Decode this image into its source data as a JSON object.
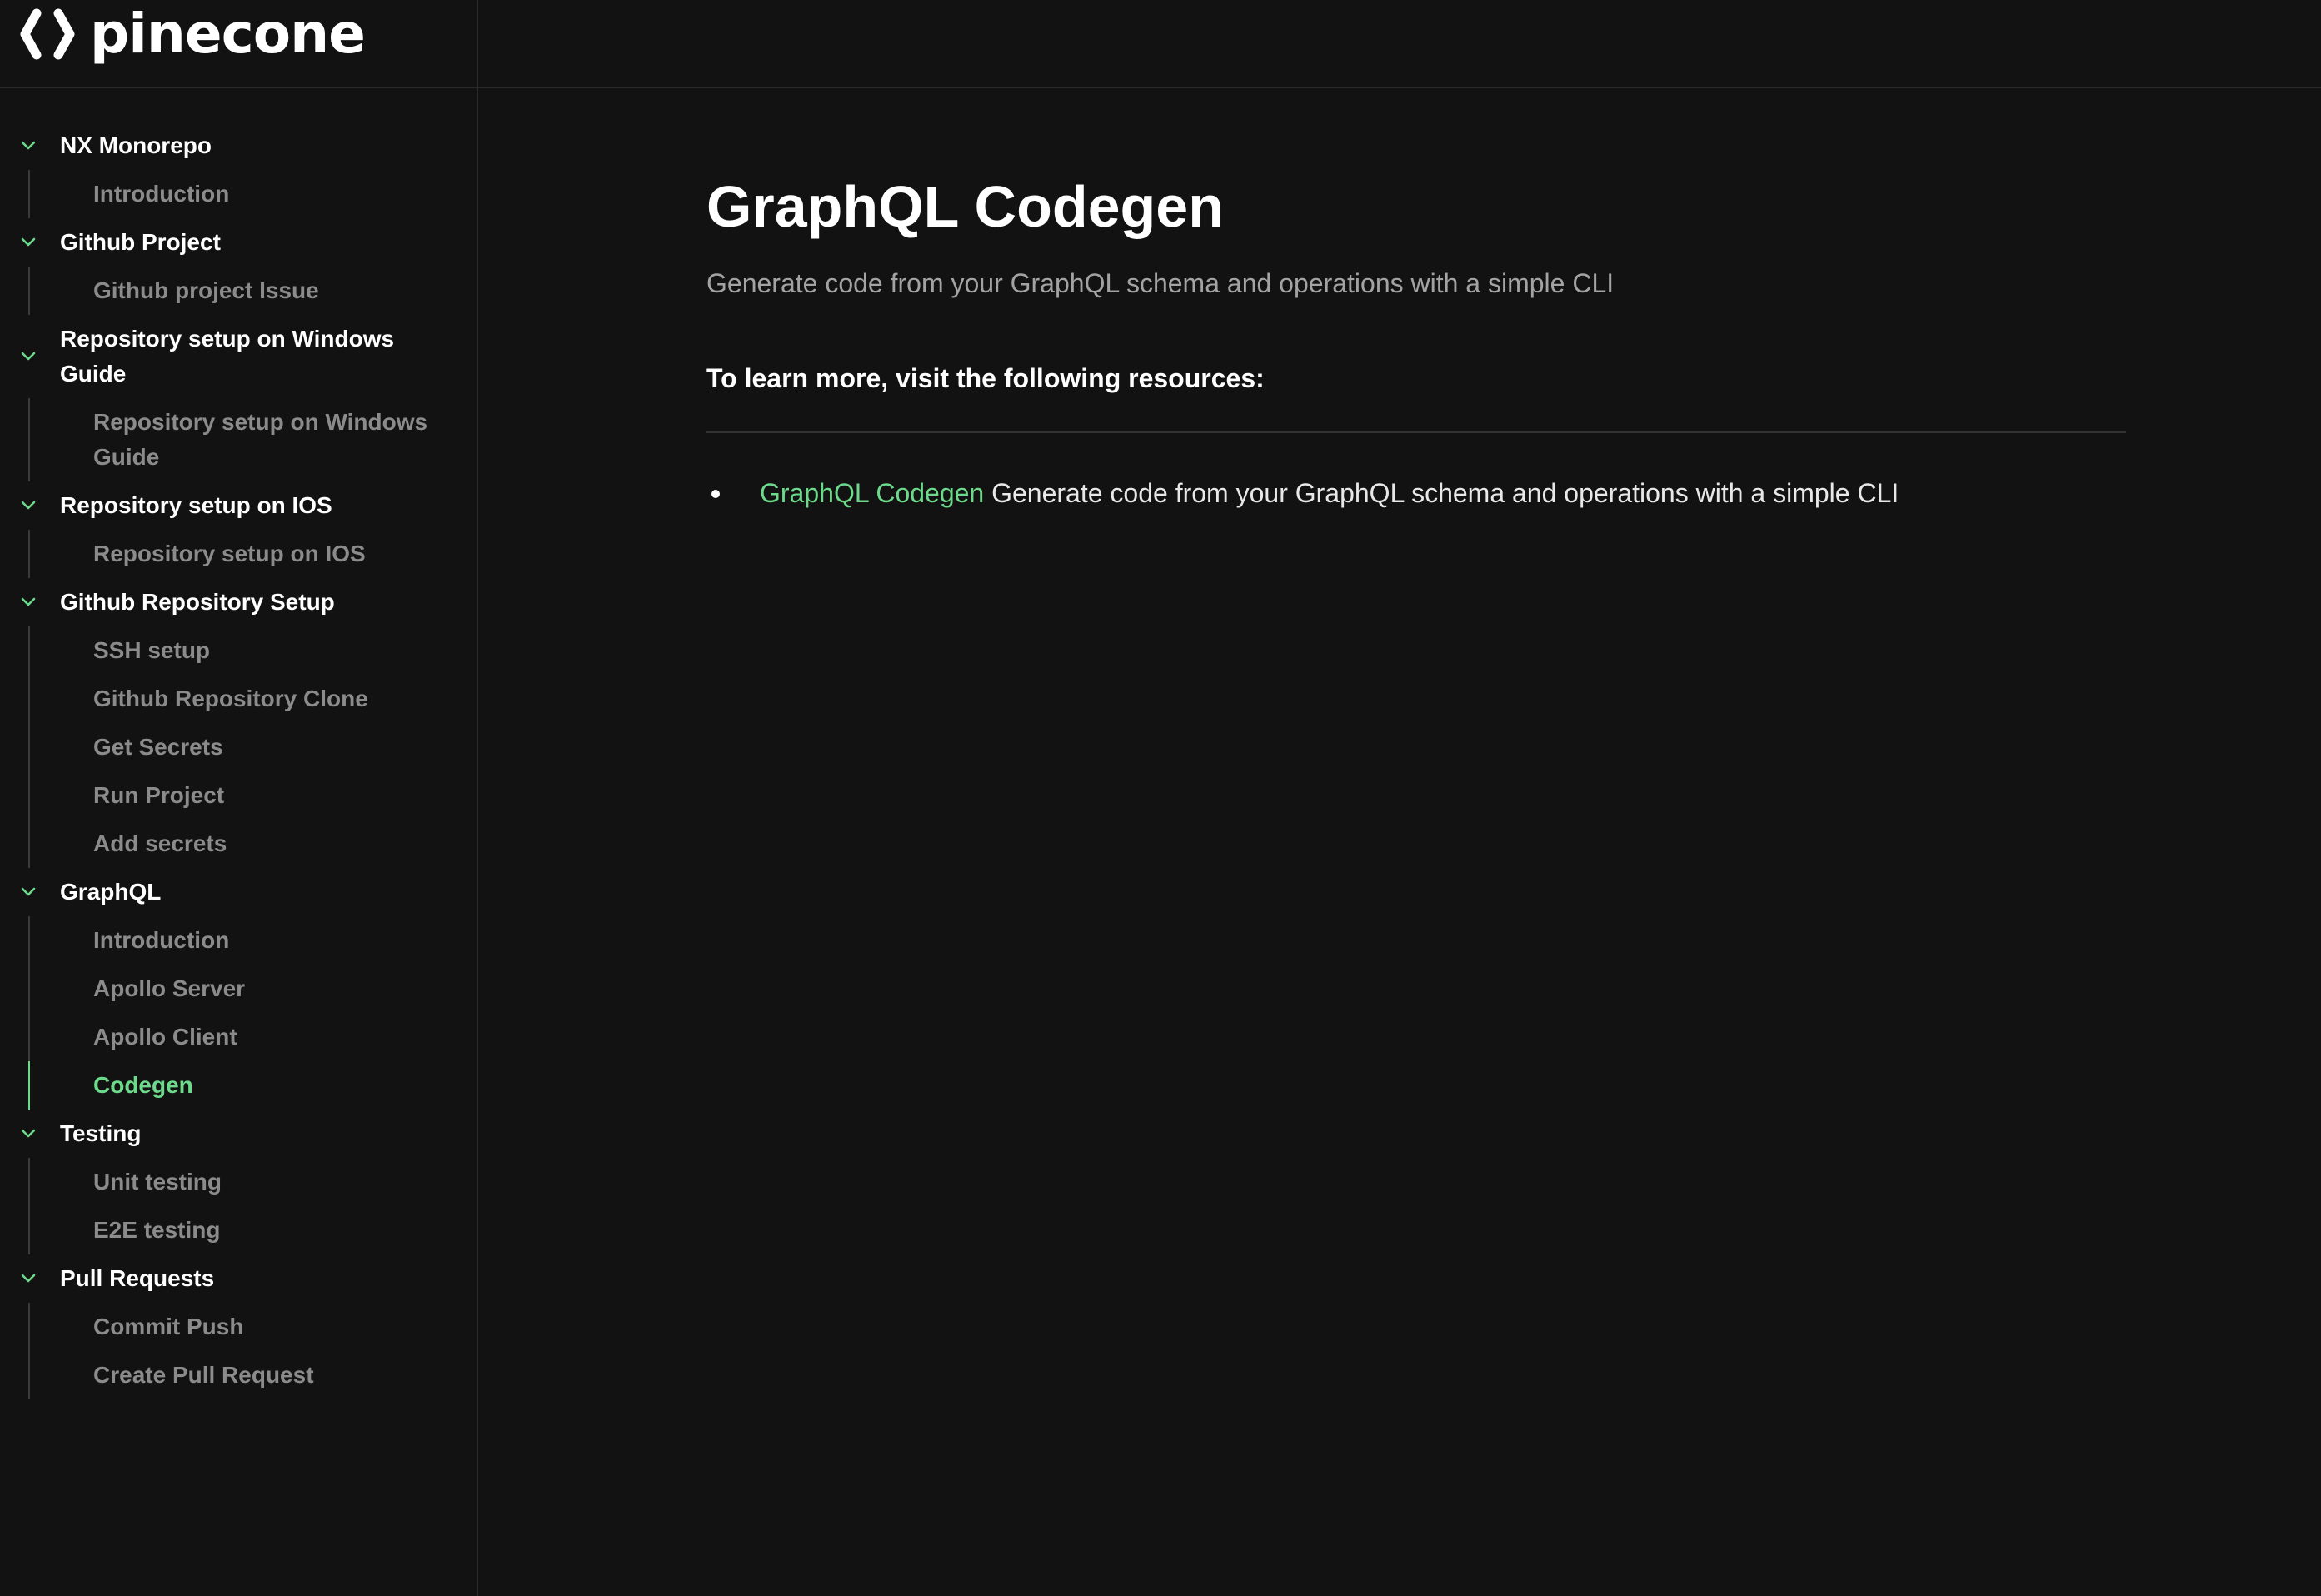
{
  "brand": {
    "name": "pinecone",
    "icon": "pinecone-logo-icon"
  },
  "colors": {
    "background": "#121212",
    "accent": "#6cd98b",
    "muted_text": "#8b8b8b",
    "border": "#2a2a2a"
  },
  "sidebar": {
    "groups": [
      {
        "label": "NX Monorepo",
        "items": [
          "Introduction"
        ]
      },
      {
        "label": "Github Project",
        "items": [
          "Github project Issue"
        ]
      },
      {
        "label": "Repository setup on Windows Guide",
        "items": [
          "Repository setup on Windows Guide"
        ]
      },
      {
        "label": "Repository setup on IOS",
        "items": [
          "Repository setup on IOS"
        ]
      },
      {
        "label": "Github Repository Setup",
        "items": [
          "SSH setup",
          "Github Repository Clone",
          "Get Secrets",
          "Run Project",
          "Add secrets"
        ]
      },
      {
        "label": "GraphQL",
        "items": [
          "Introduction",
          "Apollo Server",
          "Apollo Client",
          "Codegen"
        ]
      },
      {
        "label": "Testing",
        "items": [
          "Unit testing",
          "E2E testing"
        ]
      },
      {
        "label": "Pull Requests",
        "items": [
          "Commit Push",
          "Create Pull Request"
        ]
      }
    ],
    "active": {
      "group": "GraphQL",
      "item": "Codegen"
    }
  },
  "main": {
    "title": "GraphQL Codegen",
    "subtitle": "Generate code from your GraphQL schema and operations with a simple CLI",
    "resources_heading": "To learn more, visit the following resources:",
    "resources": [
      {
        "link_text": "GraphQL Codegen",
        "description": "Generate code from your GraphQL schema and operations with a simple CLI"
      }
    ]
  }
}
